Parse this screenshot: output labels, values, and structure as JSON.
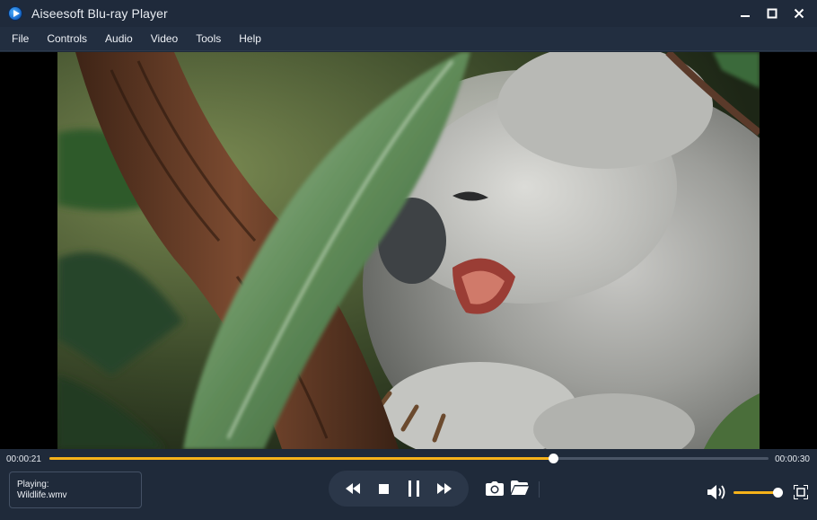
{
  "window": {
    "title": "Aiseesoft Blu-ray Player",
    "icons": {
      "app": "play-disc-icon",
      "minimize": "minimize-icon",
      "maximize": "maximize-icon",
      "close": "close-icon"
    }
  },
  "menu": {
    "items": [
      {
        "label": "File"
      },
      {
        "label": "Controls"
      },
      {
        "label": "Audio"
      },
      {
        "label": "Video"
      },
      {
        "label": "Tools"
      },
      {
        "label": "Help"
      }
    ]
  },
  "video": {
    "content": "koala-video-frame"
  },
  "playback": {
    "current_time": "00:00:21",
    "total_time": "00:00:30",
    "progress_fraction": 0.7,
    "accent_color": "#f6b21a"
  },
  "now_playing": {
    "label": "Playing:",
    "file": "Wildlife.wmv"
  },
  "transport": {
    "icons": [
      "rewind-icon",
      "stop-icon",
      "pause-icon",
      "fast-forward-icon"
    ]
  },
  "tools": {
    "icons": [
      "camera-icon",
      "folder-icon",
      "volume-icon",
      "fullscreen-icon"
    ]
  },
  "volume": {
    "level_fraction": 0.98
  }
}
